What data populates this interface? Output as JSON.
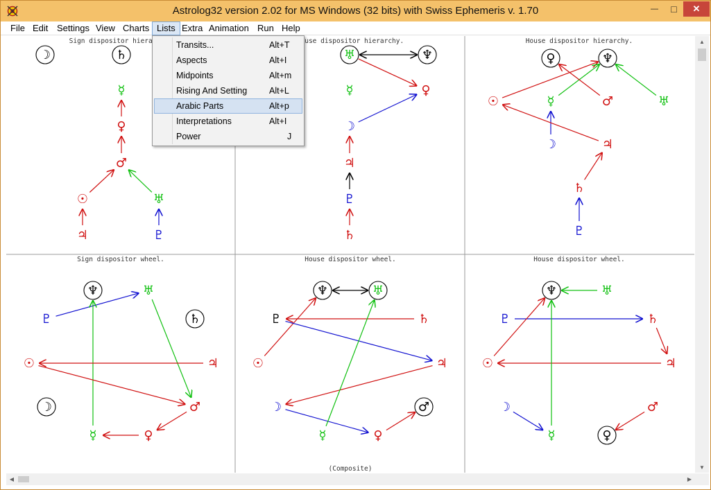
{
  "window": {
    "title": "Astrolog32 version 2.02 for MS Windows (32 bits) with Swiss Ephemeris v. 1.70",
    "minimize_glyph": "—",
    "maximize_glyph": "□",
    "close_glyph": "✕"
  },
  "menubar": {
    "items": [
      "File",
      "Edit",
      "Settings",
      "View",
      "Charts",
      "Lists",
      "Extra",
      "Animation",
      "Run",
      "Help"
    ],
    "active": "Lists"
  },
  "lists_menu": {
    "items": [
      {
        "label": "Transits...",
        "shortcut": "Alt+T"
      },
      {
        "label": "Aspects",
        "shortcut": "Alt+I"
      },
      {
        "label": "Midpoints",
        "shortcut": "Alt+m"
      },
      {
        "label": "Rising And Setting",
        "shortcut": "Alt+L"
      },
      {
        "label": "Arabic Parts",
        "shortcut": "Alt+p"
      },
      {
        "label": "Interpretations",
        "shortcut": "Alt+I"
      },
      {
        "label": "Power",
        "shortcut": "J"
      }
    ],
    "highlighted": "Arabic Parts"
  },
  "charts": {
    "captions": [
      "Sign dispositor hierarchy.",
      "House dispositor hierarchy.",
      "House dispositor hierarchy.",
      "Sign dispositor wheel.",
      "House dispositor wheel.",
      "House dispositor wheel."
    ],
    "footer": "(Composite)",
    "panel_ids": [
      "sign-hierarchy",
      "house-hierarchy-1",
      "house-hierarchy-2",
      "sign-wheel",
      "house-wheel-1",
      "house-wheel-2"
    ],
    "glyphs": {
      "sun": "☉",
      "moon": "☽",
      "mercury": "☿",
      "venus": "♀",
      "mars": "♂",
      "jupiter": "♃",
      "saturn": "♄",
      "uranus": "♅",
      "neptune": "♆",
      "pluto": "♇"
    },
    "colors": {
      "red": "#d01010",
      "green": "#10c010",
      "blue": "#1010d0",
      "black": "#000000",
      "grid": "#999999"
    }
  },
  "panels": [
    {
      "nodes": [
        {
          "p": "moon",
          "c": "black",
          "circled": true
        },
        {
          "p": "saturn",
          "c": "black",
          "circled": true
        },
        {
          "p": "mercury",
          "c": "green"
        },
        {
          "p": "venus",
          "c": "red"
        },
        {
          "p": "mars",
          "c": "red"
        },
        {
          "p": "sun",
          "c": "red"
        },
        {
          "p": "uranus",
          "c": "green"
        },
        {
          "p": "jupiter",
          "c": "red"
        },
        {
          "p": "pluto",
          "c": "blue"
        }
      ],
      "links": [
        {
          "from": "venus",
          "to": "mercury",
          "c": "red"
        },
        {
          "from": "mars",
          "to": "venus",
          "c": "red"
        },
        {
          "from": "sun",
          "to": "mars",
          "c": "red"
        },
        {
          "from": "uranus",
          "to": "mars",
          "c": "green"
        },
        {
          "from": "jupiter",
          "to": "sun",
          "c": "red"
        },
        {
          "from": "pluto",
          "to": "uranus",
          "c": "blue"
        }
      ]
    },
    {
      "nodes": [
        {
          "p": "uranus",
          "c": "green",
          "circled": true
        },
        {
          "p": "neptune",
          "c": "black",
          "circled": true
        },
        {
          "p": "mercury",
          "c": "green"
        },
        {
          "p": "venus",
          "c": "red"
        },
        {
          "p": "moon",
          "c": "blue"
        },
        {
          "p": "jupiter",
          "c": "red"
        },
        {
          "p": "pluto",
          "c": "blue"
        },
        {
          "p": "saturn",
          "c": "red"
        }
      ],
      "links": [
        {
          "from": "uranus",
          "to": "neptune",
          "c": "black",
          "both": true
        },
        {
          "from": "uranus",
          "to": "venus",
          "c": "red"
        },
        {
          "from": "moon",
          "to": "venus",
          "c": "blue"
        },
        {
          "from": "jupiter",
          "to": "moon",
          "c": "red"
        },
        {
          "from": "pluto",
          "to": "jupiter",
          "c": "black"
        },
        {
          "from": "saturn",
          "to": "pluto",
          "c": "red"
        }
      ]
    },
    {
      "nodes": [
        {
          "p": "venus",
          "c": "black",
          "circled": true
        },
        {
          "p": "neptune",
          "c": "black",
          "circled": true
        },
        {
          "p": "sun",
          "c": "red"
        },
        {
          "p": "mercury",
          "c": "green"
        },
        {
          "p": "mars",
          "c": "red"
        },
        {
          "p": "uranus",
          "c": "green"
        },
        {
          "p": "moon",
          "c": "blue"
        },
        {
          "p": "jupiter",
          "c": "red"
        },
        {
          "p": "saturn",
          "c": "red"
        },
        {
          "p": "pluto",
          "c": "blue"
        }
      ],
      "links": [
        {
          "from": "sun",
          "to": "neptune",
          "c": "red"
        },
        {
          "from": "mercury",
          "to": "neptune",
          "c": "green"
        },
        {
          "from": "mars",
          "to": "venus",
          "c": "red"
        },
        {
          "from": "uranus",
          "to": "neptune",
          "c": "green"
        },
        {
          "from": "moon",
          "to": "mercury",
          "c": "blue"
        },
        {
          "from": "jupiter",
          "to": "sun",
          "c": "red"
        },
        {
          "from": "saturn",
          "to": "jupiter",
          "c": "red"
        },
        {
          "from": "pluto",
          "to": "saturn",
          "c": "blue"
        }
      ]
    },
    {
      "nodes": [
        {
          "p": "neptune",
          "c": "black",
          "circled": true
        },
        {
          "p": "uranus",
          "c": "green"
        },
        {
          "p": "pluto",
          "c": "blue"
        },
        {
          "p": "saturn",
          "c": "black",
          "circled": true
        },
        {
          "p": "sun",
          "c": "red"
        },
        {
          "p": "jupiter",
          "c": "red"
        },
        {
          "p": "moon",
          "c": "black",
          "circled": true
        },
        {
          "p": "mars",
          "c": "red"
        },
        {
          "p": "mercury",
          "c": "green"
        },
        {
          "p": "venus",
          "c": "red"
        }
      ],
      "links": [
        {
          "from": "pluto",
          "to": "uranus",
          "c": "blue"
        },
        {
          "from": "uranus",
          "to": "mars",
          "c": "green"
        },
        {
          "from": "mercury",
          "to": "neptune",
          "c": "green"
        },
        {
          "from": "jupiter",
          "to": "sun",
          "c": "red"
        },
        {
          "from": "sun",
          "to": "mars",
          "c": "red"
        },
        {
          "from": "mars",
          "to": "venus",
          "c": "red"
        },
        {
          "from": "venus",
          "to": "mercury",
          "c": "red"
        }
      ]
    },
    {
      "nodes": [
        {
          "p": "neptune",
          "c": "black",
          "circled": true
        },
        {
          "p": "uranus",
          "c": "green",
          "circled": true
        },
        {
          "p": "pluto",
          "c": "black"
        },
        {
          "p": "saturn",
          "c": "red"
        },
        {
          "p": "sun",
          "c": "red"
        },
        {
          "p": "jupiter",
          "c": "red"
        },
        {
          "p": "moon",
          "c": "blue"
        },
        {
          "p": "mars",
          "c": "black",
          "circled": true
        },
        {
          "p": "mercury",
          "c": "green"
        },
        {
          "p": "venus",
          "c": "red"
        }
      ],
      "links": [
        {
          "from": "neptune",
          "to": "uranus",
          "c": "black",
          "both": true
        },
        {
          "from": "sun",
          "to": "neptune",
          "c": "red"
        },
        {
          "from": "saturn",
          "to": "pluto",
          "c": "red"
        },
        {
          "from": "pluto",
          "to": "jupiter",
          "c": "blue"
        },
        {
          "from": "jupiter",
          "to": "moon",
          "c": "red"
        },
        {
          "from": "moon",
          "to": "venus",
          "c": "blue"
        },
        {
          "from": "mercury",
          "to": "uranus",
          "c": "green"
        },
        {
          "from": "venus",
          "to": "mars",
          "c": "red"
        }
      ]
    },
    {
      "nodes": [
        {
          "p": "neptune",
          "c": "black",
          "circled": true
        },
        {
          "p": "uranus",
          "c": "green"
        },
        {
          "p": "pluto",
          "c": "blue"
        },
        {
          "p": "saturn",
          "c": "red"
        },
        {
          "p": "sun",
          "c": "red"
        },
        {
          "p": "jupiter",
          "c": "red"
        },
        {
          "p": "moon",
          "c": "blue"
        },
        {
          "p": "mars",
          "c": "red"
        },
        {
          "p": "mercury",
          "c": "green"
        },
        {
          "p": "venus",
          "c": "black",
          "circled": true
        }
      ],
      "links": [
        {
          "from": "uranus",
          "to": "neptune",
          "c": "green"
        },
        {
          "from": "pluto",
          "to": "saturn",
          "c": "blue"
        },
        {
          "from": "saturn",
          "to": "jupiter",
          "c": "red"
        },
        {
          "from": "jupiter",
          "to": "sun",
          "c": "red"
        },
        {
          "from": "sun",
          "to": "neptune",
          "c": "red"
        },
        {
          "from": "mercury",
          "to": "neptune",
          "c": "green"
        },
        {
          "from": "moon",
          "to": "mercury",
          "c": "blue"
        },
        {
          "from": "mars",
          "to": "venus",
          "c": "red"
        }
      ]
    }
  ]
}
